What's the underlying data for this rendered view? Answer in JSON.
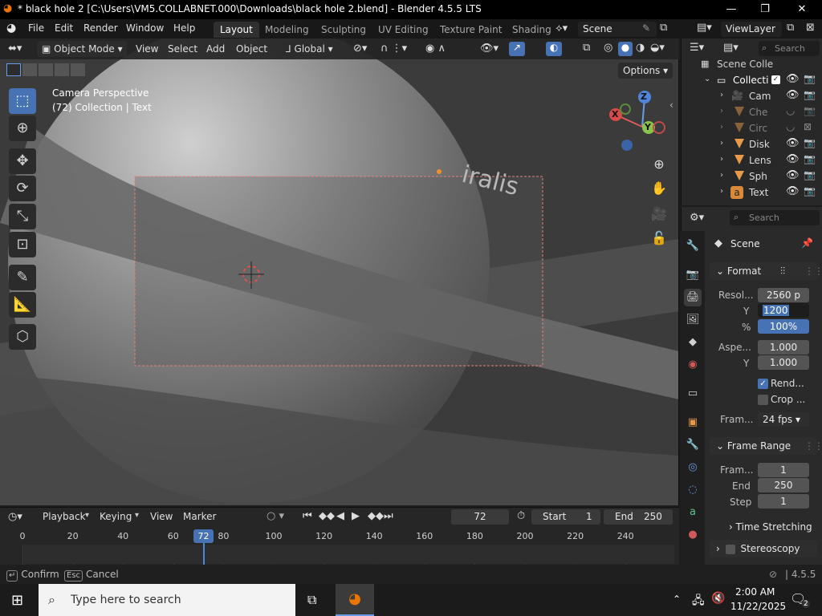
{
  "window": {
    "title": "* black hole 2 [C:\\Users\\VM5.COLLABNET.000\\Downloads\\black hole 2.blend] - Blender 4.5.5 LTS",
    "minimize_label": "—",
    "maximize_label": "❐",
    "close_label": "✕"
  },
  "menubar": {
    "items": [
      "File",
      "Edit",
      "Render",
      "Window",
      "Help"
    ],
    "workspaces": [
      "Layout",
      "Modeling",
      "Sculpting",
      "UV Editing",
      "Texture Paint",
      "Shading"
    ],
    "active_workspace": "Layout",
    "scene": "Scene",
    "view_layer": "ViewLayer"
  },
  "viewport": {
    "mode": "Object Mode",
    "menus": [
      "View",
      "Select",
      "Add",
      "Object"
    ],
    "transform_orientation": "Global",
    "options_label": "Options",
    "overlay_line1": "Camera Perspective",
    "overlay_line2": "(72) Collection | Text",
    "text_object": "iralis",
    "gizmo": {
      "x": "X",
      "y": "Y",
      "z": "Z"
    }
  },
  "outliner": {
    "search_placeholder": "Search",
    "rows": [
      {
        "name": "Scene Colle",
        "type": "scene"
      },
      {
        "name": "Collecti",
        "type": "collection"
      },
      {
        "name": "Cam",
        "type": "camera",
        "visible": true
      },
      {
        "name": "Che",
        "type": "mesh",
        "visible": false
      },
      {
        "name": "Circ",
        "type": "mesh",
        "visible": false
      },
      {
        "name": "Disk",
        "type": "mesh",
        "visible": true
      },
      {
        "name": "Lens",
        "type": "mesh",
        "visible": true
      },
      {
        "name": "Sph",
        "type": "mesh",
        "visible": true
      },
      {
        "name": "Text",
        "type": "text",
        "visible": true
      }
    ]
  },
  "properties": {
    "search_placeholder": "Search",
    "context": "Scene",
    "format": {
      "header": "Format",
      "resolution_label": "Resol...",
      "resolution_x": "2560 p",
      "y_label": "Y",
      "resolution_y": "1200",
      "percent_label": "%",
      "percent": "100%",
      "aspect_label": "Aspe...",
      "aspect_x": "1.000",
      "aspect_y": "1.000",
      "render_region": "Rend...",
      "crop": "Crop ...",
      "frame_rate_label": "Fram...",
      "frame_rate": "24 fps"
    },
    "frame_range": {
      "header": "Frame Range",
      "start_label": "Fram...",
      "start": "1",
      "end_label": "End",
      "end": "250",
      "step_label": "Step",
      "step": "1"
    },
    "time_stretching": "Time Stretching",
    "stereoscopy": "Stereoscopy"
  },
  "timeline": {
    "menus": [
      "Playback",
      "Keying",
      "View",
      "Marker"
    ],
    "current_frame": "72",
    "start_label": "Start",
    "start": "1",
    "end_label": "End",
    "end": "250",
    "ticks": [
      "0",
      "20",
      "40",
      "60",
      "80",
      "100",
      "120",
      "140",
      "160",
      "180",
      "200",
      "220",
      "240"
    ],
    "playhead": "72"
  },
  "statusbar": {
    "confirm": "Confirm",
    "cancel_key": "Esc",
    "cancel": "Cancel",
    "version": "4.5.5"
  },
  "taskbar": {
    "search_placeholder": "Type here to search",
    "time": "2:00 AM",
    "date": "11/22/2025",
    "notification_count": "2"
  }
}
